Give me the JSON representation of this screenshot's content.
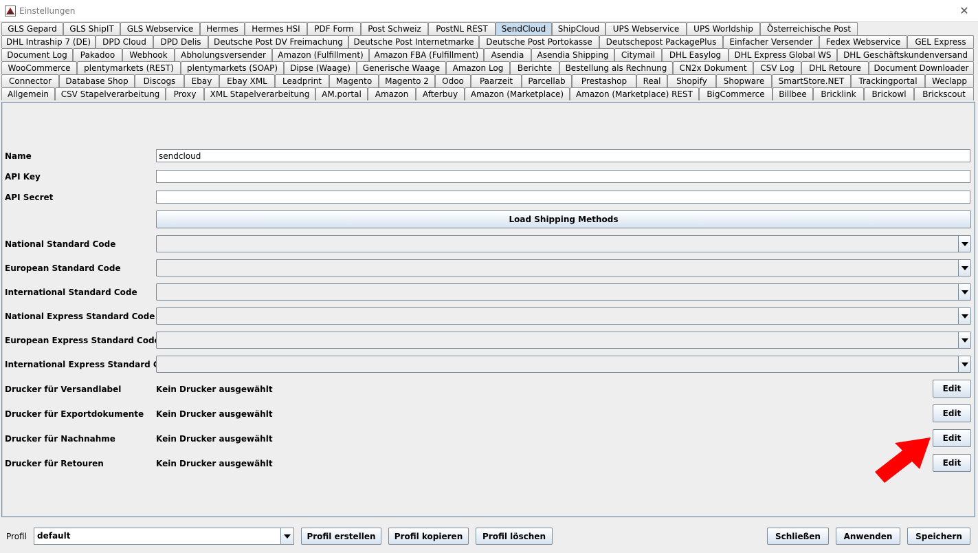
{
  "window": {
    "title": "Einstellungen",
    "close_glyph": "✕"
  },
  "tabs": {
    "selected": "SendCloud",
    "rows": [
      [
        "GLS Gepard",
        "GLS ShipIT",
        "GLS Webservice",
        "Hermes",
        "Hermes HSI",
        "PDF Form",
        "Post Schweiz",
        "PostNL REST",
        "SendCloud",
        "ShipCloud",
        "UPS Webservice",
        "UPS Worldship",
        "Österreichische Post"
      ],
      [
        "DHL Intraship 7 (DE)",
        "DPD Cloud",
        "DPD Delis",
        "Deutsche Post DV Freimachung",
        "Deutsche Post Internetmarke",
        "Deutsche Post Portokasse",
        "Deutschepost PackagePlus",
        "Einfacher Versender",
        "Fedex Webservice",
        "GEL Express"
      ],
      [
        "Document Log",
        "Pakadoo",
        "Webhook",
        "Abholungsversender",
        "Amazon (Fulfillment)",
        "Amazon FBA (Fulfillment)",
        "Asendia",
        "Asendia Shipping",
        "Citymail",
        "DHL Easylog",
        "DHL Express Global WS",
        "DHL Geschäftskundenversand"
      ],
      [
        "WooCommerce",
        "plentymarkets (REST)",
        "plentymarkets (SOAP)",
        "Dipse (Waage)",
        "Generische Waage",
        "Amazon Log",
        "Berichte",
        "Bestellung als Rechnung",
        "CN2x Dokument",
        "CSV Log",
        "DHL Retoure",
        "Document Downloader"
      ],
      [
        "Connector",
        "Database Shop",
        "Discogs",
        "Ebay",
        "Ebay XML",
        "Leadprint",
        "Magento",
        "Magento 2",
        "Odoo",
        "Paarzeit",
        "Parcellab",
        "Prestashop",
        "Real",
        "Shopify",
        "Shopware",
        "SmartStore.NET",
        "Trackingportal",
        "Weclapp"
      ],
      [
        "Allgemein",
        "CSV Stapelverarbeitung",
        "Proxy",
        "XML Stapelverarbeitung",
        "AM.portal",
        "Amazon",
        "Afterbuy",
        "Amazon (Marketplace)",
        "Amazon (Marketplace) REST",
        "BigCommerce",
        "Billbee",
        "Bricklink",
        "Brickowl",
        "Brickscout"
      ]
    ]
  },
  "form": {
    "name_label": "Name",
    "name_value": "sendcloud",
    "api_key_label": "API Key",
    "api_key_value": "",
    "api_secret_label": "API Secret",
    "api_secret_value": "",
    "load_button": "Load Shipping Methods",
    "national_label": "National Standard Code",
    "european_label": "European Standard Code",
    "international_label": "International Standard Code",
    "national_express_label": "National Express Standard Code",
    "european_express_label": "European Express Standard Code",
    "international_express_label": "International Express Standard Code"
  },
  "printers": [
    {
      "label": "Drucker für Versandlabel",
      "value": "Kein Drucker ausgewählt",
      "button": "Edit"
    },
    {
      "label": "Drucker für Exportdokumente",
      "value": "Kein Drucker ausgewählt",
      "button": "Edit"
    },
    {
      "label": "Drucker für Nachnahme",
      "value": "Kein Drucker ausgewählt",
      "button": "Edit"
    },
    {
      "label": "Drucker für Retouren",
      "value": "Kein Drucker ausgewählt",
      "button": "Edit"
    }
  ],
  "annotation": {
    "arrow_color": "#ff0000"
  },
  "footer": {
    "profile_label": "Profil",
    "profile_value": "default",
    "create": "Profil erstellen",
    "copy": "Profil kopieren",
    "delete": "Profil löschen",
    "close": "Schließen",
    "apply": "Anwenden",
    "save": "Speichern"
  }
}
